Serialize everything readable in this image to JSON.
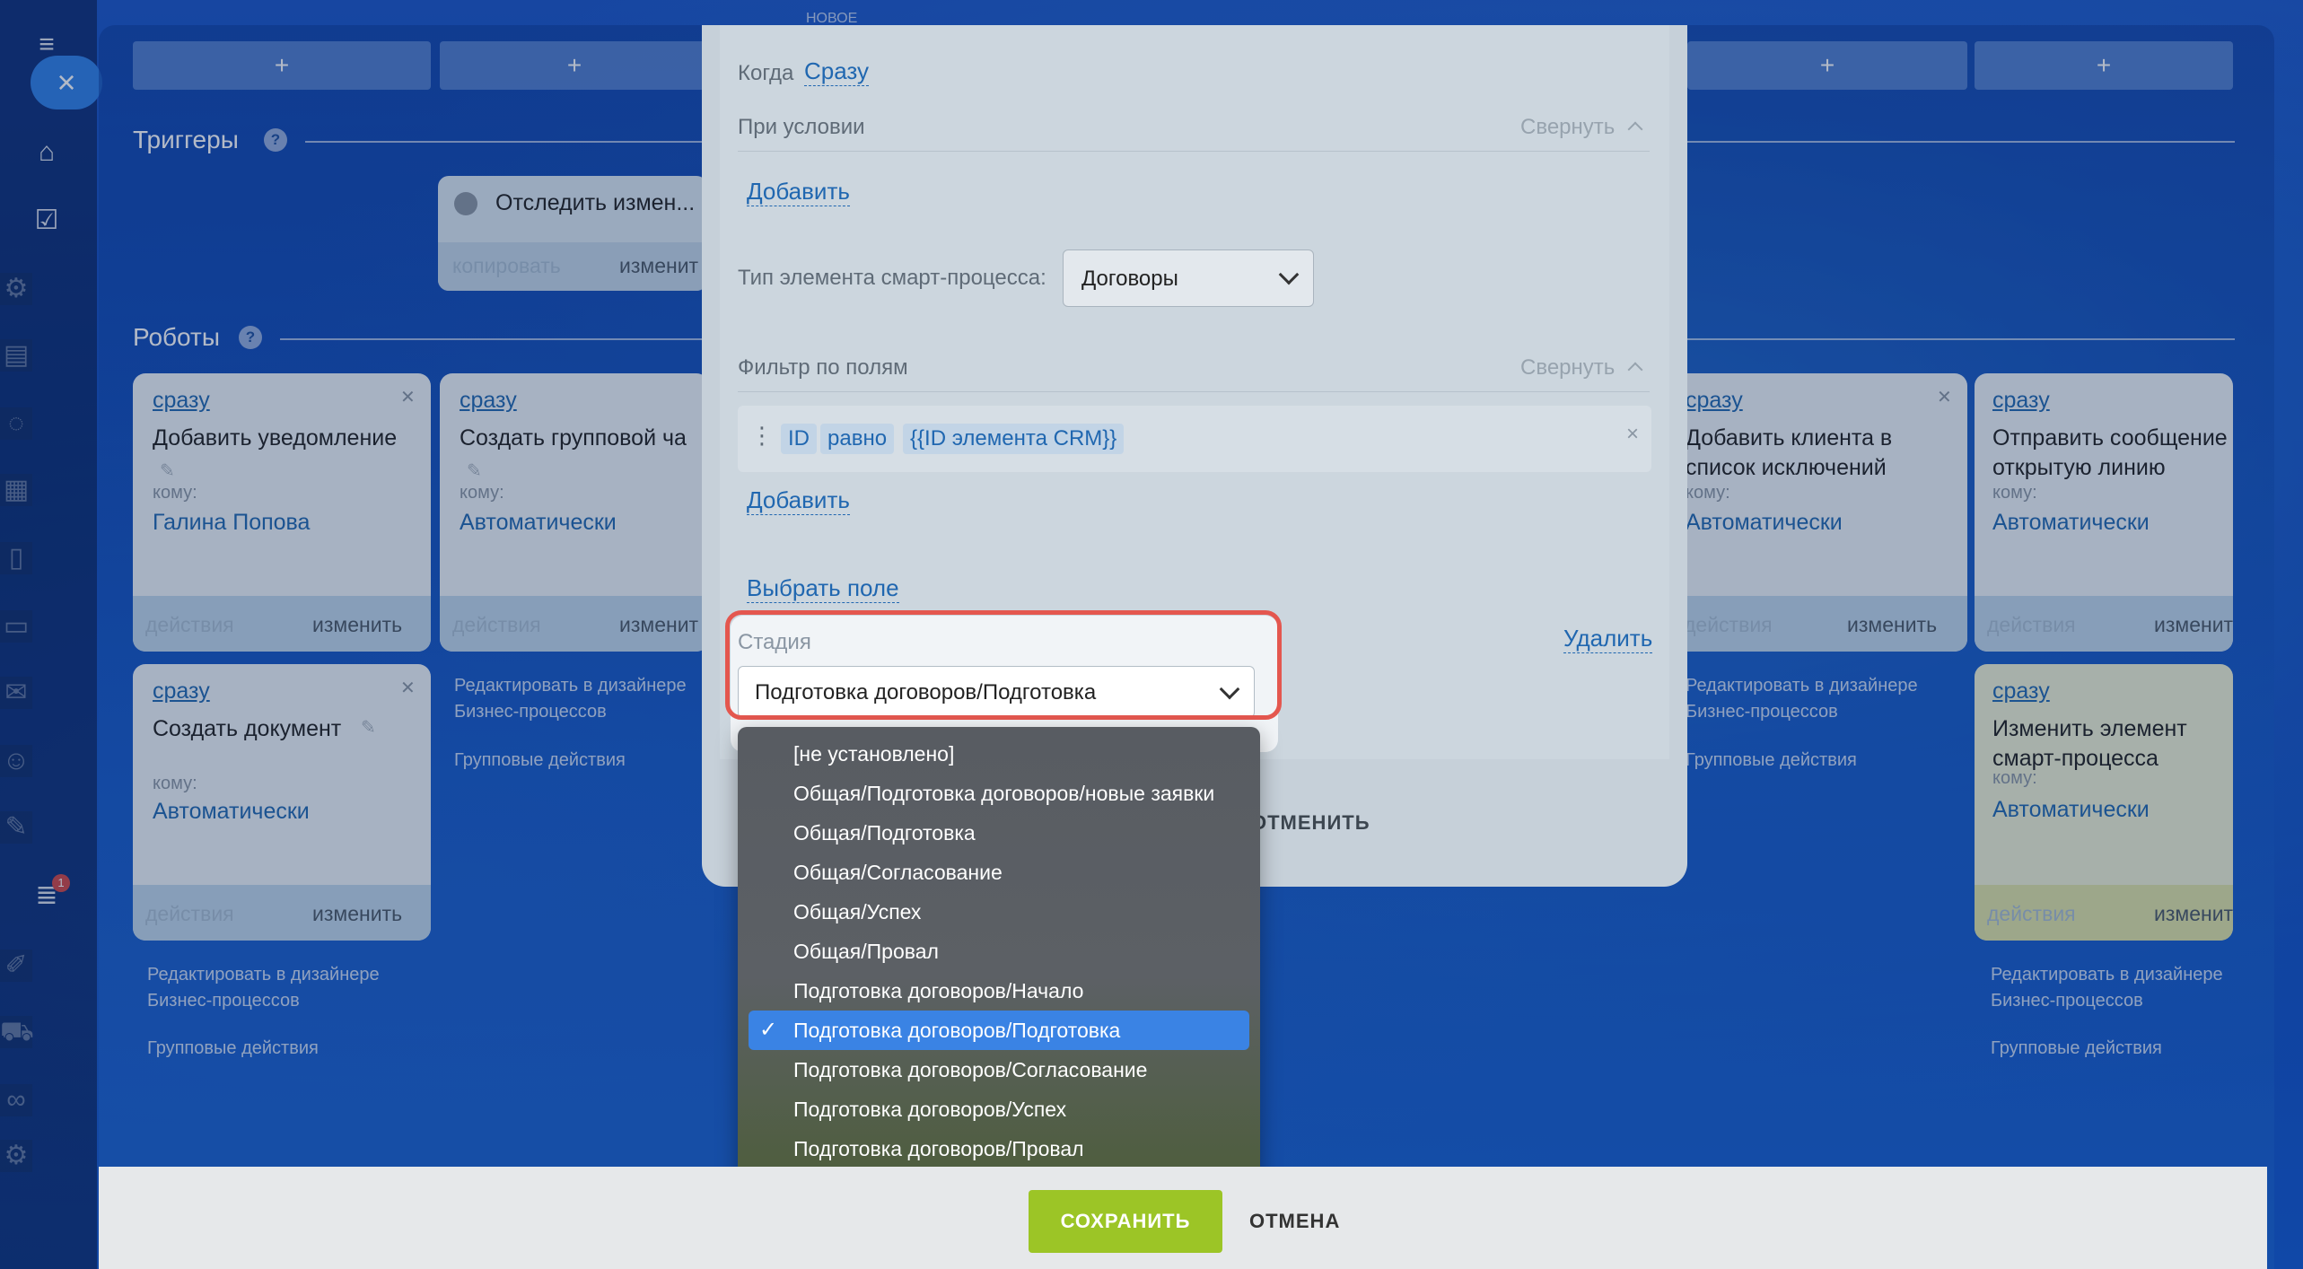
{
  "topbar": {
    "new_label": "НОВОЕ",
    "badge_count": "1"
  },
  "columns": {
    "add_label": "+"
  },
  "triggers": {
    "title": "Триггеры",
    "help": "?",
    "card": {
      "title": "Отследить измен...",
      "copy": "копировать",
      "edit": "изменит"
    }
  },
  "robots": {
    "title": "Роботы",
    "help": "?",
    "cards": [
      {
        "when": "сразу",
        "title": "Добавить уведомление",
        "to": "кому:",
        "who": "Галина Попова",
        "actions": "действия",
        "edit": "изменить"
      },
      {
        "when": "сразу",
        "title": "Создать групповой ча",
        "to": "кому:",
        "who": "Автоматически",
        "actions": "действия",
        "edit": "изменит"
      },
      {
        "when": "сразу",
        "title": "Создать документ",
        "to": "кому:",
        "who": "Автоматически",
        "actions": "действия",
        "edit": "изменить"
      },
      {
        "when": "сразу",
        "title": "Добавить клиента в список исключений",
        "to": "кому:",
        "who": "Автоматически",
        "actions": "действия",
        "edit": "изменить"
      },
      {
        "when": "сразу",
        "title": "Отправить сообщение открытую линию",
        "to": "кому:",
        "who": "Автоматически",
        "actions": "действия",
        "edit": "изменит"
      },
      {
        "when": "сразу",
        "title": "Изменить элемент смарт-процесса",
        "to": "кому:",
        "who": "Автоматически",
        "actions": "действия",
        "edit": "изменит"
      }
    ],
    "designer_link": "Редактировать в дизайнере Бизнес-процессов",
    "group_actions": "Групповые действия"
  },
  "modal": {
    "when_label": "Когда",
    "when_value": "Сразу",
    "condition_label": "При условии",
    "collapse": "Свернуть",
    "add": "Добавить",
    "type_label": "Тип элемента смарт-процесса:",
    "type_value": "Договоры",
    "filter_label": "Фильтр по полям",
    "filter": {
      "field": "ID",
      "op": "равно",
      "value": "{{ID элемента CRM}}",
      "remove": "×"
    },
    "choose_field": "Выбрать поле",
    "delete": "Удалить",
    "stage_label": "Стадия",
    "stage_value": "Подготовка договоров/Подготовка",
    "cancel_under": "ОТМЕНИТЬ"
  },
  "dropdown": {
    "options": [
      "[не установлено]",
      "Общая/Подготовка договоров/новые заявки",
      "Общая/Подготовка",
      "Общая/Согласование",
      "Общая/Успех",
      "Общая/Провал",
      "Подготовка договоров/Начало",
      "Подготовка договоров/Подготовка",
      "Подготовка договоров/Согласование",
      "Подготовка договоров/Успех",
      "Подготовка договоров/Провал"
    ],
    "selected_index": 7,
    "check": "✓"
  },
  "footer": {
    "save": "СОХРАНИТЬ",
    "cancel": "ОТМЕНА"
  },
  "colors": {
    "accent": "#2067b0",
    "save": "#9cc526",
    "highlight": "#e4574f",
    "selected": "#3a83e4"
  }
}
